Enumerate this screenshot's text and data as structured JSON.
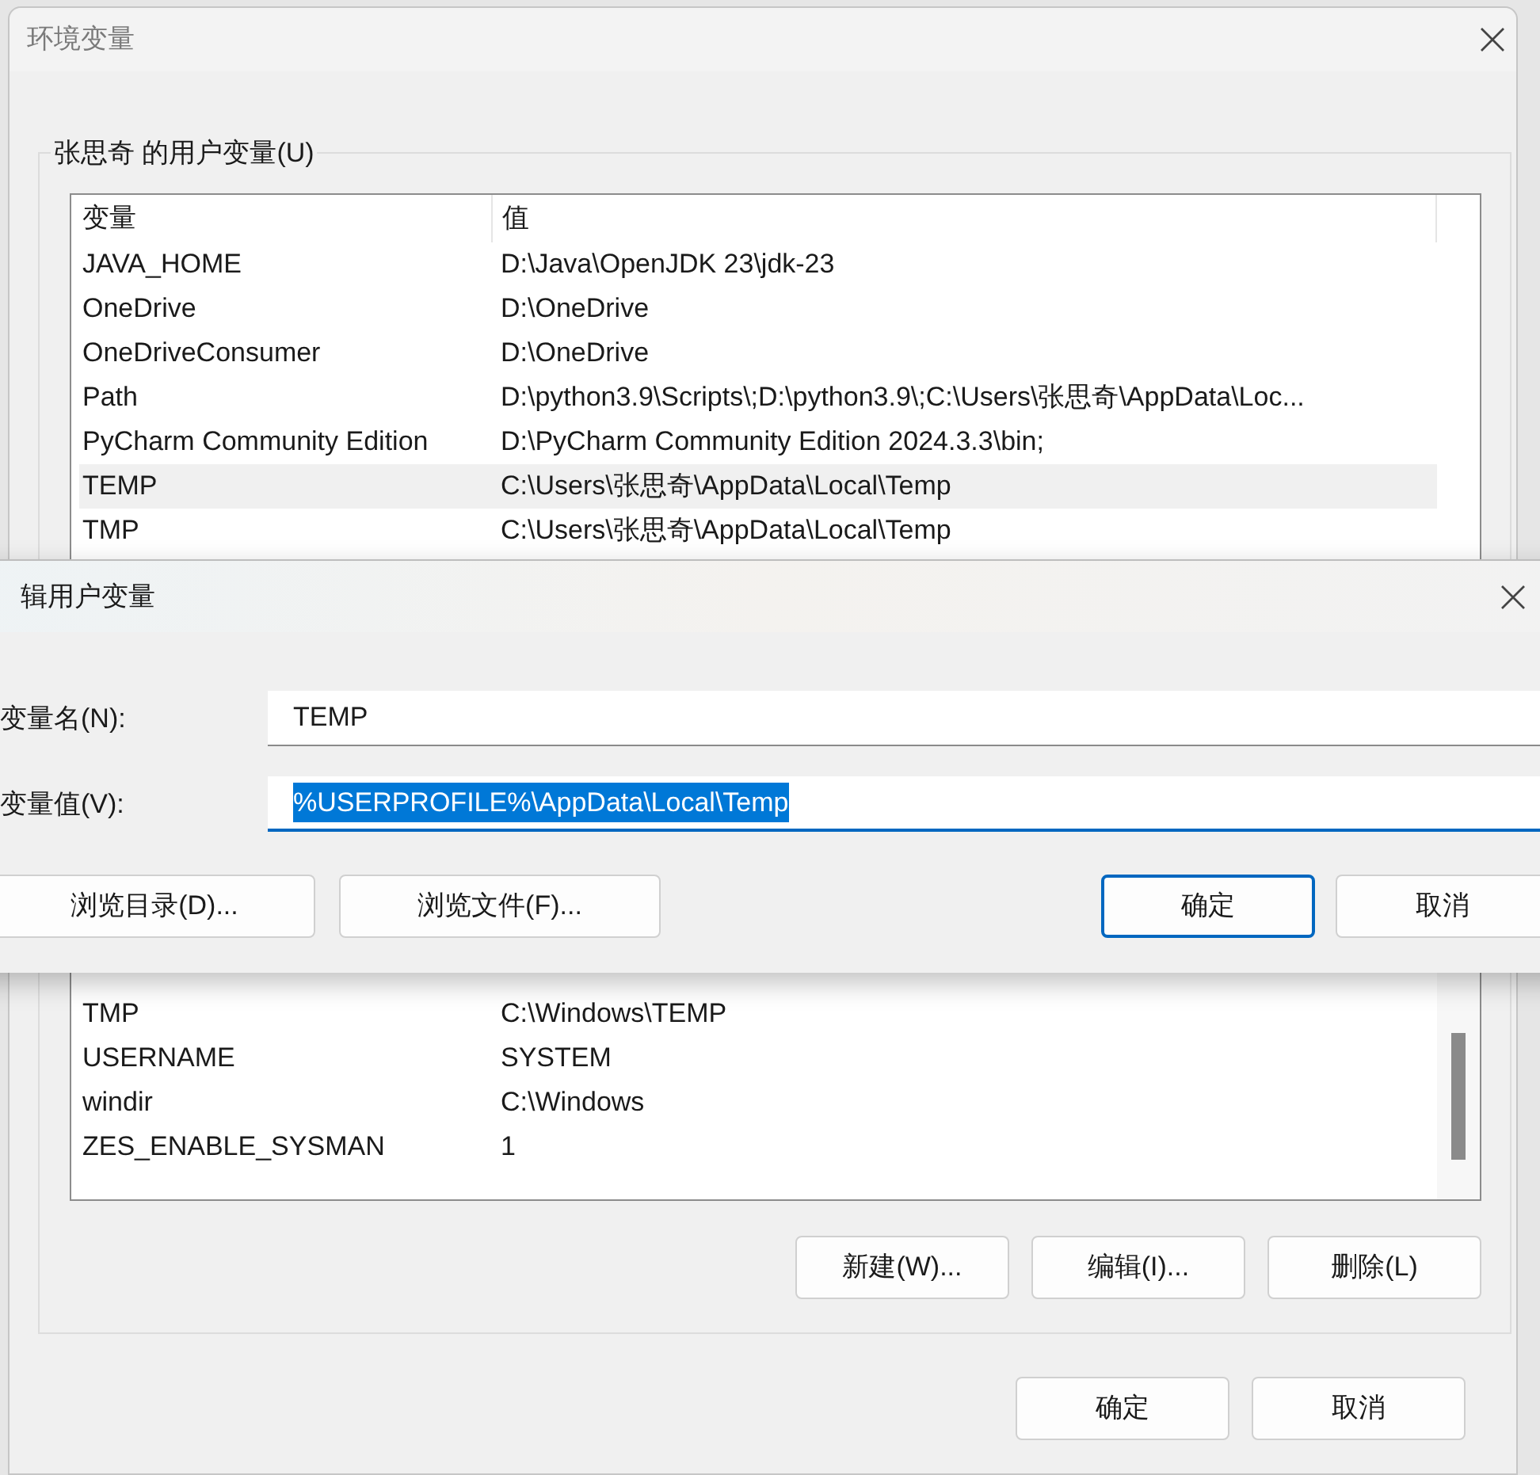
{
  "main_window": {
    "title": "环境变量",
    "user_variables": {
      "label": "张思奇 的用户变量(U)",
      "columns": [
        "变量",
        "值"
      ],
      "rows": [
        {
          "name": "JAVA_HOME",
          "value": "D:\\Java\\OpenJDK 23\\jdk-23",
          "selected": false
        },
        {
          "name": "OneDrive",
          "value": "D:\\OneDrive",
          "selected": false
        },
        {
          "name": "OneDriveConsumer",
          "value": "D:\\OneDrive",
          "selected": false
        },
        {
          "name": "Path",
          "value": "D:\\python3.9\\Scripts\\;D:\\python3.9\\;C:\\Users\\张思奇\\AppData\\Loc...",
          "selected": false
        },
        {
          "name": "PyCharm Community Edition",
          "value": "D:\\PyCharm Community Edition 2024.3.3\\bin;",
          "selected": false
        },
        {
          "name": "TEMP",
          "value": "C:\\Users\\张思奇\\AppData\\Local\\Temp",
          "selected": true
        },
        {
          "name": "TMP",
          "value": "C:\\Users\\张思奇\\AppData\\Local\\Temp",
          "selected": false
        }
      ]
    },
    "system_variables": {
      "rows": [
        {
          "name": "TMP",
          "value": "C:\\Windows\\TEMP"
        },
        {
          "name": "USERNAME",
          "value": "SYSTEM"
        },
        {
          "name": "windir",
          "value": "C:\\Windows"
        },
        {
          "name": "ZES_ENABLE_SYSMAN",
          "value": "1"
        }
      ],
      "buttons": [
        "新建(W)...",
        "编辑(I)...",
        "删除(L)"
      ]
    },
    "buttons": [
      "确定",
      "取消"
    ]
  },
  "edit_dialog": {
    "title": "辑用户变量",
    "fields": [
      {
        "label": "变量名(N):",
        "value": "TEMP",
        "focused": false,
        "text_selected": false
      },
      {
        "label": "变量值(V):",
        "value": "%USERPROFILE%\\AppData\\Local\\Temp",
        "focused": true,
        "text_selected": true
      }
    ],
    "buttons": [
      {
        "label": "浏览目录(D)...",
        "default": false
      },
      {
        "label": "浏览文件(F)...",
        "default": false
      },
      {
        "label": "确定",
        "default": true
      },
      {
        "label": "取消",
        "default": false
      }
    ]
  }
}
